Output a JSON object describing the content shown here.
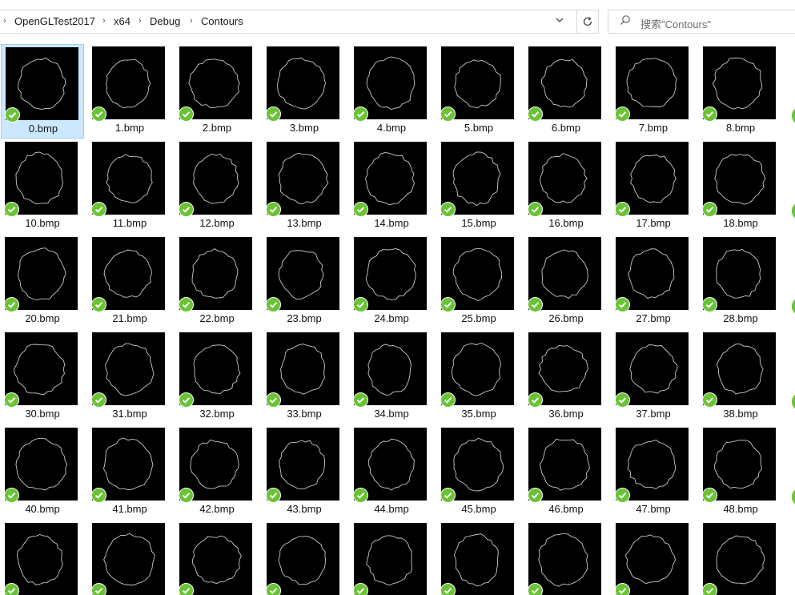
{
  "breadcrumb": {
    "items": [
      "OpenGLTest2017",
      "x64",
      "Debug",
      "Contours"
    ],
    "separator": "›"
  },
  "toolbar": {
    "refresh_icon": "refresh-icon",
    "dropdown_icon": "chevron-down-icon"
  },
  "search": {
    "placeholder": "搜索\"Contours\""
  },
  "colors": {
    "accent_check": "#6ac334",
    "selection_bg": "#cce8ff",
    "thumb_bg": "#000000"
  },
  "files": {
    "rows": [
      [
        "0.bmp",
        "1.bmp",
        "2.bmp",
        "3.bmp",
        "4.bmp",
        "5.bmp",
        "6.bmp",
        "7.bmp",
        "8.bmp"
      ],
      [
        "10.bmp",
        "11.bmp",
        "12.bmp",
        "13.bmp",
        "14.bmp",
        "15.bmp",
        "16.bmp",
        "17.bmp",
        "18.bmp"
      ],
      [
        "20.bmp",
        "21.bmp",
        "22.bmp",
        "23.bmp",
        "24.bmp",
        "25.bmp",
        "26.bmp",
        "27.bmp",
        "28.bmp"
      ],
      [
        "30.bmp",
        "31.bmp",
        "32.bmp",
        "33.bmp",
        "34.bmp",
        "35.bmp",
        "36.bmp",
        "37.bmp",
        "38.bmp"
      ],
      [
        "40.bmp",
        "41.bmp",
        "42.bmp",
        "43.bmp",
        "44.bmp",
        "45.bmp",
        "46.bmp",
        "47.bmp",
        "48.bmp"
      ],
      [
        "",
        "",
        "",
        "",
        "",
        "",
        "",
        "",
        ""
      ]
    ],
    "selected": "0.bmp",
    "sync_status_icon": "sync-ok-check-icon"
  }
}
